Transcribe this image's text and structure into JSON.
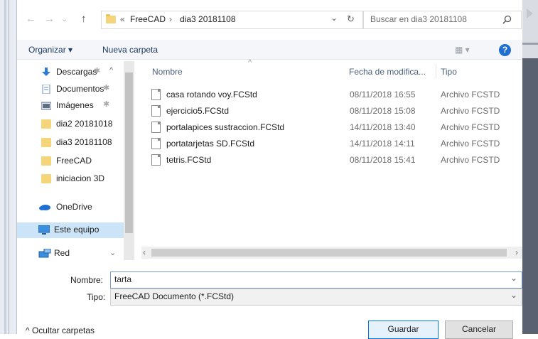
{
  "nav_buttons": {
    "back": "←",
    "forward": "→",
    "dropdown": "⌄",
    "up": "↑"
  },
  "address": {
    "prefix": "«",
    "crumbs": [
      "FreeCAD",
      "dia3 20181108"
    ],
    "separator": "›",
    "refresh": "↻"
  },
  "search": {
    "placeholder": "Buscar en dia3 20181108",
    "icon": "search-icon"
  },
  "toolbar": {
    "organize": "Organizar ▾",
    "new_folder": "Nueva carpeta",
    "view": "▦ ▾",
    "help": "?"
  },
  "sidebar": {
    "items": [
      {
        "label": "Descargas",
        "icon": "download-icon",
        "pinned": true
      },
      {
        "label": "Documentos",
        "icon": "document-icon",
        "pinned": true
      },
      {
        "label": "Imágenes",
        "icon": "image-icon",
        "pinned": true
      },
      {
        "label": "dia2 20181018",
        "icon": "folder-icon"
      },
      {
        "label": "dia3 20181108",
        "icon": "folder-icon"
      },
      {
        "label": "FreeCAD",
        "icon": "folder-icon"
      },
      {
        "label": "iniciacion 3D",
        "icon": "folder-icon"
      },
      {
        "label": "OneDrive",
        "icon": "cloud-icon"
      },
      {
        "label": "Este equipo",
        "icon": "computer-icon",
        "selected": true
      },
      {
        "label": "Red",
        "icon": "network-icon"
      }
    ]
  },
  "columns": {
    "name": "Nombre",
    "date": "Fecha de modifica...",
    "type": "Tipo"
  },
  "files": [
    {
      "name": "casa rotando voy.FCStd",
      "date": "08/11/2018 16:55",
      "type": "Archivo FCSTD"
    },
    {
      "name": "ejercicio5.FCStd",
      "date": "08/11/2018 15:08",
      "type": "Archivo FCSTD"
    },
    {
      "name": "portalapices sustraccion.FCStd",
      "date": "14/11/2018 13:40",
      "type": "Archivo FCSTD"
    },
    {
      "name": "portatarjetas SD.FCStd",
      "date": "14/11/2018 14:11",
      "type": "Archivo FCSTD"
    },
    {
      "name": "tetris.FCStd",
      "date": "08/11/2018 15:41",
      "type": "Archivo FCSTD"
    }
  ],
  "form": {
    "name_label": "Nombre:",
    "name_value": "tarta",
    "type_label": "Tipo:",
    "type_value": "FreeCAD Documento (*.FCStd)"
  },
  "footer": {
    "hide_folders": "^ Ocultar carpetas",
    "save": "Guardar",
    "cancel": "Cancelar"
  }
}
